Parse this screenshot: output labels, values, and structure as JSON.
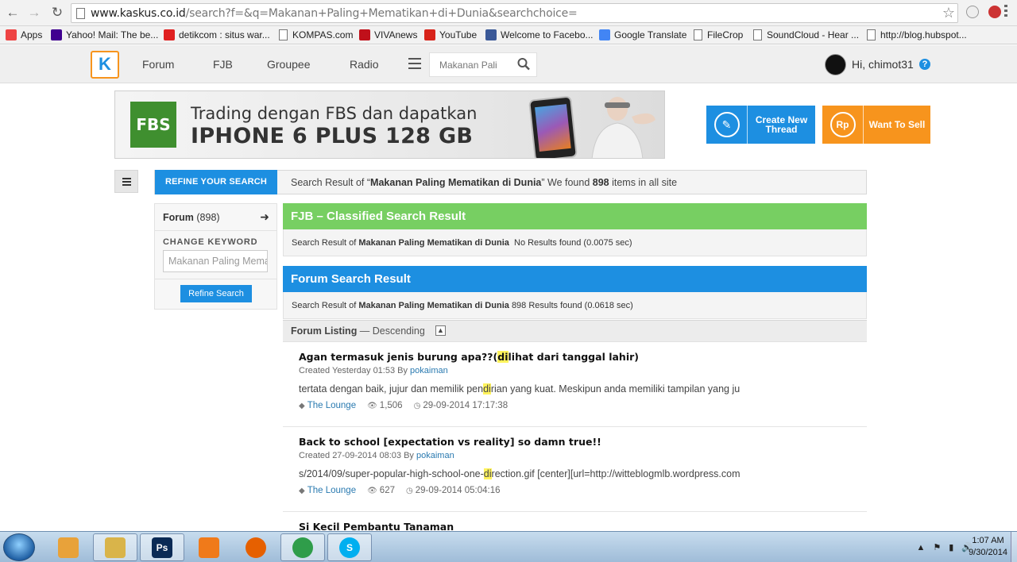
{
  "browser": {
    "url_host": "www.kaskus.co.id",
    "url_rest": "/search?f=&q=Makanan+Paling+Mematikan+di+Dunia&searchchoice="
  },
  "bookmarks": [
    {
      "label": "Apps",
      "icon": "apps-grid-icon",
      "color": "#e44"
    },
    {
      "label": "Yahoo! Mail: The be...",
      "icon": "yahoo-icon",
      "color": "#400090"
    },
    {
      "label": "detikcom : situs war...",
      "icon": "detik-icon",
      "color": "#e02020"
    },
    {
      "label": "KOMPAS.com",
      "icon": "page-icon",
      "color": "#ffffff"
    },
    {
      "label": "VIVAnews",
      "icon": "vivanews-icon",
      "color": "#c0101a"
    },
    {
      "label": "YouTube",
      "icon": "youtube-icon",
      "color": "#d8231a"
    },
    {
      "label": "Welcome to Facebo...",
      "icon": "facebook-icon",
      "color": "#3b5998"
    },
    {
      "label": "Google Translate",
      "icon": "google-translate-icon",
      "color": "#4285f4"
    },
    {
      "label": "FileCrop",
      "icon": "page-icon",
      "color": "#ffffff"
    },
    {
      "label": "SoundCloud - Hear ...",
      "icon": "page-icon",
      "color": "#ffffff"
    },
    {
      "label": "http://blog.hubspot...",
      "icon": "page-icon",
      "color": "#ffffff"
    }
  ],
  "header": {
    "logo_text": "K",
    "menu": [
      "Forum",
      "FJB",
      "Groupee",
      "Radio"
    ],
    "search_value": "Makanan Pali",
    "greeting": "Hi, chimot31",
    "help": "?"
  },
  "banner": {
    "logo": "FBS",
    "line1": "Trading dengan FBS dan dapatkan",
    "line2": "IPHONE 6 PLUS 128 GB"
  },
  "cta": {
    "create_thread": "Create New Thread",
    "want_to_sell": "Want To Sell",
    "rp_symbol": "Rp",
    "blue": "#1d8fe1",
    "orange": "#f7941d"
  },
  "search": {
    "refine_tab": "REFINE YOUR SEARCH",
    "summary_prefix": "Search Result of “",
    "query": "Makanan Paling Mematikan di Dunia",
    "summary_mid": "” We found ",
    "total": "898",
    "summary_suffix": " items in all site"
  },
  "left_panel": {
    "forum_label": "Forum",
    "forum_count": "(898)",
    "change_keyword": "CHANGE KEYWORD",
    "keyword_value": "Makanan Paling Mematikan di Dunia",
    "refine_button": "Refine Search"
  },
  "fjb": {
    "title": "FJB – Classified Search Result",
    "prefix": "Search Result of ",
    "query": "Makanan Paling Mematikan di Dunia",
    "result": "No Results found (0.0075 sec)",
    "color": "#77cf62"
  },
  "forum": {
    "title": "Forum Search Result",
    "prefix": "Search Result of ",
    "query": "Makanan Paling Mematikan di Dunia",
    "result": "898 Results found (0.0618 sec)",
    "color": "#1d8fe1"
  },
  "listing": {
    "title": "Forum Listing",
    "order": " — Descending"
  },
  "threads": [
    {
      "title_pre": "Agan termasuk jenis burung apa??(",
      "title_hl": "di",
      "title_post": "lihat dari tanggal lahir)",
      "created": "Created Yesterday 01:53 By ",
      "author": "pokaiman",
      "excerpt_pre": "tertata dengan baik, jujur dan memilik pen",
      "excerpt_hl": "di",
      "excerpt_post": "rian yang kuat. Meskipun anda memiliki tampilan yang ju",
      "forum": "The Lounge",
      "views": "1,506",
      "last": "29-09-2014 17:17:38"
    },
    {
      "title_pre": "Back to school [expectation vs reality] so damn true!!",
      "title_hl": "",
      "title_post": "",
      "created": "Created 27-09-2014 08:03 By ",
      "author": "pokaiman",
      "excerpt_pre": "s/2014/09/super-popular-high-school-one-",
      "excerpt_hl": "di",
      "excerpt_post": "rection.gif [center][url=http://witteblogmlb.wordpress.com",
      "forum": "The Lounge",
      "views": "627",
      "last": "29-09-2014 05:04:16"
    },
    {
      "title_pre": "Si Kecil Pembantu Tanaman",
      "title_hl": "",
      "title_post": "",
      "created": "",
      "author": "",
      "excerpt_pre": "",
      "excerpt_hl": "",
      "excerpt_post": "",
      "forum": "",
      "views": "",
      "last": ""
    }
  ],
  "taskbar": {
    "time": "1:07 AM",
    "date": "9/30/2014",
    "apps": [
      {
        "name": "gallery-icon",
        "label": "",
        "color": "#e8a23a"
      },
      {
        "name": "explorer-icon",
        "label": "",
        "color": "#d9b44a"
      },
      {
        "name": "photoshop-icon",
        "label": "Ps",
        "color": "#0a2a55"
      },
      {
        "name": "media-player-icon",
        "label": "",
        "color": "#f07a1a"
      },
      {
        "name": "firefox-icon",
        "label": "",
        "color": "#e66000"
      },
      {
        "name": "chrome-icon",
        "label": "",
        "color": "#2f9d4a"
      },
      {
        "name": "skype-icon",
        "label": "S",
        "color": "#00aff0"
      }
    ]
  }
}
